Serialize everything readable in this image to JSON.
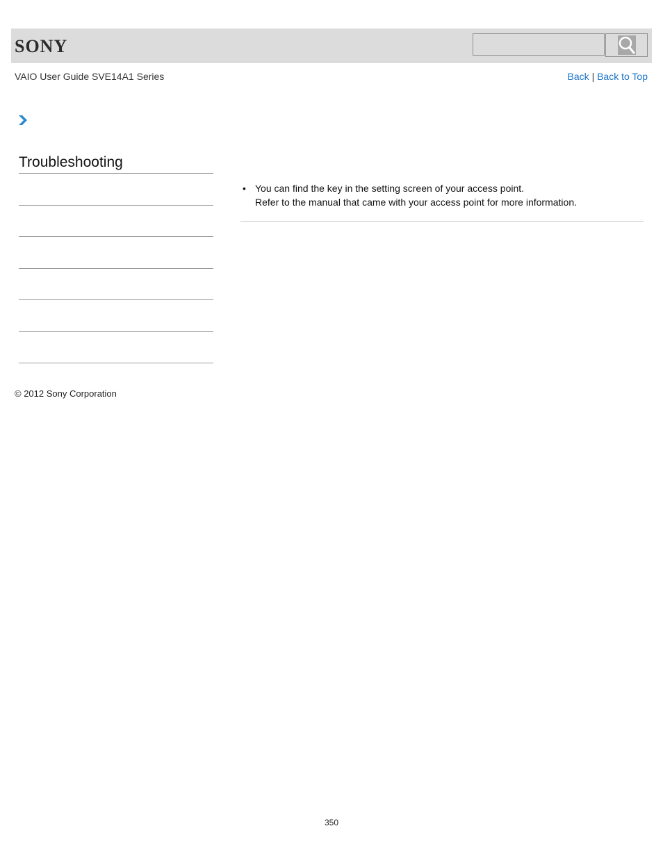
{
  "header": {
    "brand": "SONY",
    "search": {
      "value": "",
      "placeholder": ""
    },
    "search_button_icon": "magnifier-icon"
  },
  "guide_title": "VAIO User Guide SVE14A1 Series",
  "nav": {
    "back": "Back",
    "separator": "|",
    "back_to_top": "Back to Top"
  },
  "breadcrumb_icon": "chevron-right-icon",
  "sidebar": {
    "title": "Troubleshooting",
    "items": [
      "",
      "",
      "",
      "",
      "",
      ""
    ]
  },
  "content": {
    "bullets": [
      {
        "line1": "You can find the key in the setting screen of your access point.",
        "line2": "Refer to the manual that came with your access point for more information."
      }
    ]
  },
  "footer": {
    "copyright": "© 2012 Sony Corporation",
    "page_number": "350"
  },
  "colors": {
    "link": "#1a74c9",
    "header_bg": "#dcdcdc",
    "chevron": "#2a8ad0"
  }
}
